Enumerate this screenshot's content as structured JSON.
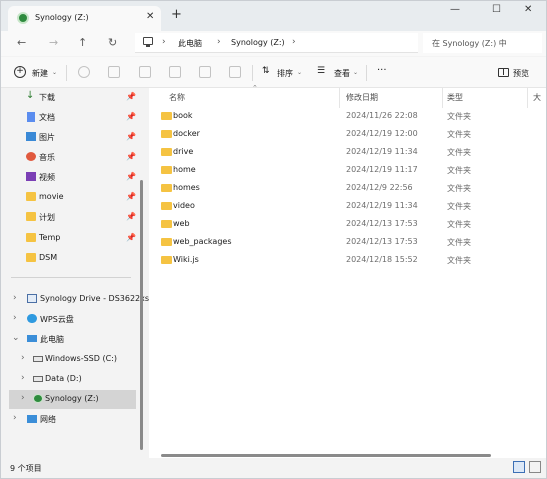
{
  "window": {
    "tab_title": "Synology (Z:)",
    "tab_close": "✕",
    "new_tab": "+",
    "minimize": "—",
    "maximize": "☐",
    "close": "✕"
  },
  "address": {
    "back": "←",
    "forward": "→",
    "up": "↑",
    "refresh": "↻",
    "crumbs": [
      "此电脑",
      "Synology (Z:)"
    ],
    "separator": "›",
    "search_placeholder": "在 Synology (Z:) 中"
  },
  "toolbar": {
    "new_label": "新建",
    "sort_label": "排序",
    "view_label": "查看",
    "more_label": "···",
    "preview_label": "预览"
  },
  "nav": {
    "quick": [
      {
        "label": "下载",
        "icon": "download-icon",
        "color": "#2f7d32"
      },
      {
        "label": "文档",
        "icon": "documents-icon",
        "color": "#5b8def"
      },
      {
        "label": "图片",
        "icon": "pictures-icon",
        "color": "#3a89d6"
      },
      {
        "label": "音乐",
        "icon": "music-icon",
        "color": "#e0593e"
      },
      {
        "label": "视频",
        "icon": "videos-icon",
        "color": "#7b3fb5"
      },
      {
        "label": "movie",
        "icon": "folder-icon",
        "color": "#f5c342"
      },
      {
        "label": "计划",
        "icon": "folder-icon",
        "color": "#f5c342"
      },
      {
        "label": "Temp",
        "icon": "folder-icon",
        "color": "#f5c342"
      },
      {
        "label": "DSM",
        "icon": "folder-icon",
        "color": "#f5c342"
      }
    ],
    "tree": [
      {
        "label": "Synology Drive - DS3622xs",
        "icon": "synology-drive-icon"
      },
      {
        "label": "WPS云盘",
        "icon": "cloud-icon"
      },
      {
        "label": "此电脑",
        "icon": "this-pc-icon"
      },
      {
        "label": "Windows-SSD (C:)",
        "icon": "drive-c-icon"
      },
      {
        "label": "Data (D:)",
        "icon": "drive-d-icon"
      },
      {
        "label": "Synology (Z:)",
        "icon": "synology-drive-z-icon"
      },
      {
        "label": "网络",
        "icon": "network-icon"
      }
    ]
  },
  "columns": {
    "name": "名称",
    "date": "修改日期",
    "type": "类型",
    "size": "大"
  },
  "files": [
    {
      "name": "book",
      "date": "2024/11/26 22:08",
      "type": "文件夹"
    },
    {
      "name": "docker",
      "date": "2024/12/19 12:00",
      "type": "文件夹"
    },
    {
      "name": "drive",
      "date": "2024/12/19 11:34",
      "type": "文件夹"
    },
    {
      "name": "home",
      "date": "2024/12/19 11:17",
      "type": "文件夹"
    },
    {
      "name": "homes",
      "date": "2024/12/9 22:56",
      "type": "文件夹"
    },
    {
      "name": "video",
      "date": "2024/12/19 11:34",
      "type": "文件夹"
    },
    {
      "name": "web",
      "date": "2024/12/13 17:53",
      "type": "文件夹"
    },
    {
      "name": "web_packages",
      "date": "2024/12/13 17:53",
      "type": "文件夹"
    },
    {
      "name": "Wiki.js",
      "date": "2024/12/18 15:52",
      "type": "文件夹"
    }
  ],
  "status": {
    "count": "9 个项目"
  },
  "colors": {
    "folder": "#f5c342",
    "selection": "#d4d4d4",
    "synology_green": "#2e8b3e"
  }
}
